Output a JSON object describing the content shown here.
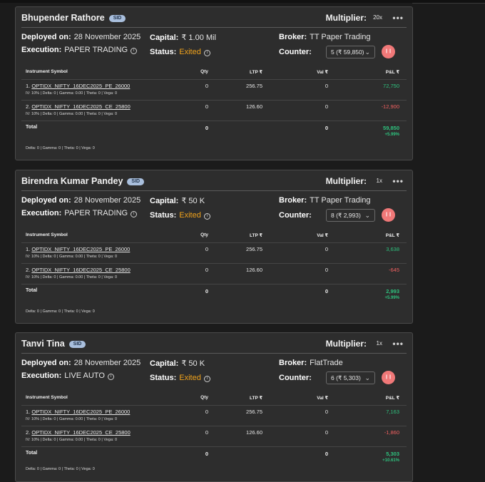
{
  "cards": [
    {
      "name": "Bhupender Rathore",
      "badge": "SID",
      "multiplier_label": "Multiplier:",
      "multiplier": "20x",
      "menu": "•••",
      "deployed_label": "Deployed on:",
      "deployed": "28 November 2025",
      "capital_label": "Capital:",
      "capital": "₹ 1.00 Mil",
      "broker_label": "Broker:",
      "broker": "TT Paper Trading",
      "execution_label": "Execution:",
      "execution": "PAPER TRADING",
      "status_label": "Status:",
      "status": "Exited",
      "counter_label": "Counter:",
      "counter": "5 (₹ 59,850)",
      "columns": [
        "Instrument Symbol",
        "Qty",
        "LTP ₹",
        "Val ₹",
        "P&L ₹"
      ],
      "rows": [
        {
          "idx": "1.",
          "symbol": "OPTIDX_NIFTY_16DEC2025_PE_26000",
          "greeks": "IV: 10% | Delta: 0 | Gamma: 0.00 | Theta: 0 | Vega: 0",
          "qty": "0",
          "ltp": "256.75",
          "val": "0",
          "pnl": "72,750",
          "sign": "pos"
        },
        {
          "idx": "2.",
          "symbol": "OPTIDX_NIFTY_16DEC2025_CE_25800",
          "greeks": "IV: 10% | Delta: 0 | Gamma: 0.00 | Theta: 0 | Vega: 0",
          "qty": "0",
          "ltp": "126.60",
          "val": "0",
          "pnl": "-12,900",
          "sign": "neg"
        }
      ],
      "total_label": "Total",
      "total_qty": "0",
      "total_val": "0",
      "total_pnl": "59,850",
      "total_pct": "+5.99%",
      "footer": "Delta: 0 | Gamma: 0 | Theta: 0 | Vega: 0"
    },
    {
      "name": "Birendra Kumar Pandey",
      "badge": "SID",
      "multiplier_label": "Multiplier:",
      "multiplier": "1x",
      "menu": "•••",
      "deployed_label": "Deployed on:",
      "deployed": "28 November 2025",
      "capital_label": "Capital:",
      "capital": "₹ 50 K",
      "broker_label": "Broker:",
      "broker": "TT Paper Trading",
      "execution_label": "Execution:",
      "execution": "PAPER TRADING",
      "status_label": "Status:",
      "status": "Exited",
      "counter_label": "Counter:",
      "counter": "8 (₹ 2,993)",
      "columns": [
        "Instrument Symbol",
        "Qty",
        "LTP ₹",
        "Val ₹",
        "P&L ₹"
      ],
      "rows": [
        {
          "idx": "1.",
          "symbol": "OPTIDX_NIFTY_16DEC2025_PE_26000",
          "greeks": "IV: 10% | Delta: 0 | Gamma: 0.00 | Theta: 0 | Vega: 0",
          "qty": "0",
          "ltp": "256.75",
          "val": "0",
          "pnl": "3,638",
          "sign": "pos"
        },
        {
          "idx": "2.",
          "symbol": "OPTIDX_NIFTY_16DEC2025_CE_25800",
          "greeks": "IV: 10% | Delta: 0 | Gamma: 0.00 | Theta: 0 | Vega: 0",
          "qty": "0",
          "ltp": "126.60",
          "val": "0",
          "pnl": "-645",
          "sign": "neg"
        }
      ],
      "total_label": "Total",
      "total_qty": "0",
      "total_val": "0",
      "total_pnl": "2,993",
      "total_pct": "+5.99%",
      "footer": "Delta: 0 | Gamma: 0 | Theta: 0 | Vega: 0"
    },
    {
      "name": "Tanvi Tina",
      "badge": "SID",
      "multiplier_label": "Multiplier:",
      "multiplier": "1x",
      "menu": "•••",
      "deployed_label": "Deployed on:",
      "deployed": "28 November 2025",
      "capital_label": "Capital:",
      "capital": "₹ 50 K",
      "broker_label": "Broker:",
      "broker": "FlatTrade",
      "execution_label": "Execution:",
      "execution": "LIVE AUTO",
      "status_label": "Status:",
      "status": "Exited",
      "counter_label": "Counter:",
      "counter": "6 (₹ 5,303)",
      "columns": [
        "Instrument Symbol",
        "Qty",
        "LTP ₹",
        "Val ₹",
        "P&L ₹"
      ],
      "rows": [
        {
          "idx": "1.",
          "symbol": "OPTIDX_NIFTY_16DEC2025_PE_26000",
          "greeks": "IV: 10% | Delta: 0 | Gamma: 0.00 | Theta: 0 | Vega: 0",
          "qty": "0",
          "ltp": "256.75",
          "val": "0",
          "pnl": "7,163",
          "sign": "pos"
        },
        {
          "idx": "2.",
          "symbol": "OPTIDX_NIFTY_16DEC2025_CE_25800",
          "greeks": "IV: 10% | Delta: 0 | Gamma: 0.00 | Theta: 0 | Vega: 0",
          "qty": "0",
          "ltp": "126.60",
          "val": "0",
          "pnl": "-1,860",
          "sign": "neg"
        }
      ],
      "total_label": "Total",
      "total_qty": "0",
      "total_val": "0",
      "total_pnl": "5,303",
      "total_pct": "+10.61%",
      "footer": "Delta: 0 | Gamma: 0 | Theta: 0 | Vega: 0"
    }
  ],
  "colors": {
    "exited": "#f0a21b",
    "positive": "#2ec27e",
    "negative": "#f06060",
    "pause_button": "#f07878"
  }
}
